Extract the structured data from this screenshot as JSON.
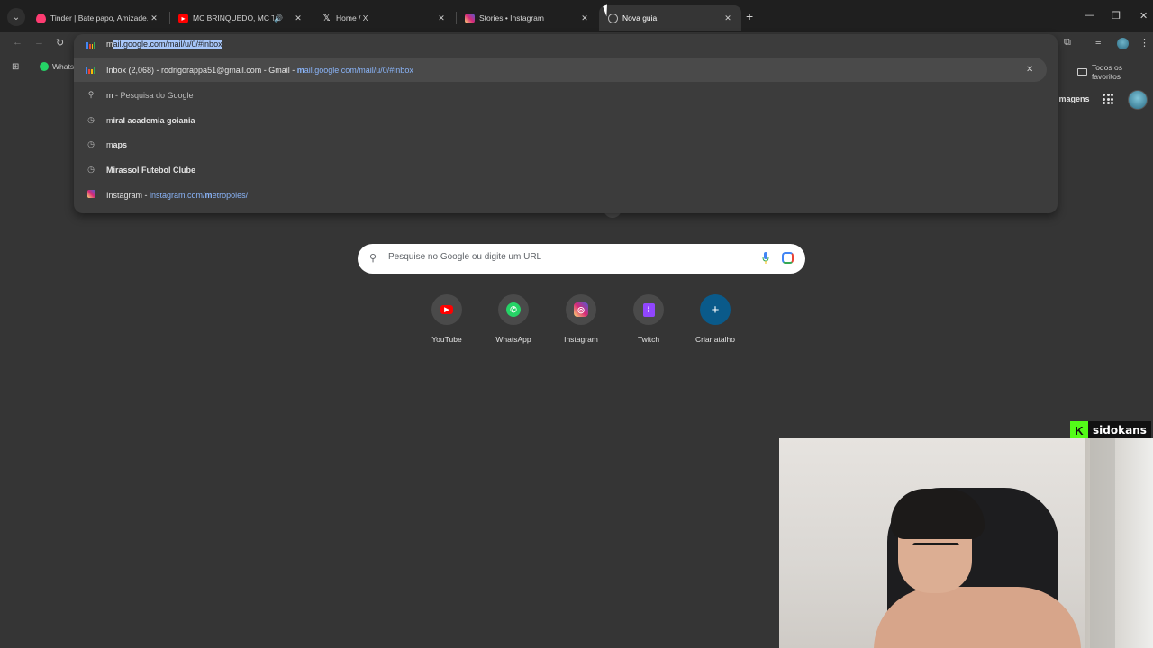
{
  "tabs": [
    {
      "title": "Tinder | Bate papo, Amizade. Encontros",
      "favicon": "tinder-icon",
      "color": "#fe3c72"
    },
    {
      "title": "MC BRINQUEDO, MC TUTO",
      "favicon": "youtube-icon",
      "color": "#ff0000",
      "audio": true
    },
    {
      "title": "Home / X",
      "favicon": "x-icon",
      "color": "#ffffff"
    },
    {
      "title": "Stories • Instagram",
      "favicon": "instagram-icon",
      "color": "#e1306c"
    },
    {
      "title": "Nova guia",
      "favicon": "chrome-icon",
      "active": true
    }
  ],
  "omnibox": {
    "typed": "m",
    "autocomplete": "ail.google.com/mail/u/0/#inbox",
    "suggestions": [
      {
        "icon": "gmail-icon",
        "pre": "Inbox (2,068) - rodrigorappa51@gmail.com - Gmail - ",
        "url_bold": "m",
        "url_rest": "ail.google.com/mail/u/0/#inbox",
        "removable": true
      },
      {
        "icon": "search-icon",
        "bold": "m",
        "rest": " - Pesquisa do Google"
      },
      {
        "icon": "history-icon",
        "plain": "m",
        "bold": "iral academia goiania"
      },
      {
        "icon": "history-icon",
        "plain": "m",
        "bold": "aps"
      },
      {
        "icon": "history-icon",
        "bold": "Mirassol Futebol Clube"
      },
      {
        "icon": "instagram-icon",
        "pre": "Instagram - ",
        "url_plain": "instagram.com/",
        "url_bold": "m",
        "url_rest": "etropoles/"
      }
    ]
  },
  "bookmarks": {
    "whatsapp": "WhatsApp",
    "all": "Todos os favoritos"
  },
  "header": {
    "images": "Imagens"
  },
  "search": {
    "placeholder": "Pesquise no Google ou digite um URL"
  },
  "shortcuts": [
    {
      "label": "YouTube",
      "icon": "youtube-icon",
      "color": "#ff0000"
    },
    {
      "label": "WhatsApp",
      "icon": "whatsapp-icon",
      "color": "#25d366"
    },
    {
      "label": "Instagram",
      "icon": "instagram-icon",
      "color": "#e1306c"
    },
    {
      "label": "Twitch",
      "icon": "twitch-icon",
      "color": "#9146ff"
    },
    {
      "label": "Criar atalho",
      "icon": "plus-icon",
      "color": "#0a5a8a"
    }
  ],
  "overlay": {
    "brand": "sidokans"
  }
}
